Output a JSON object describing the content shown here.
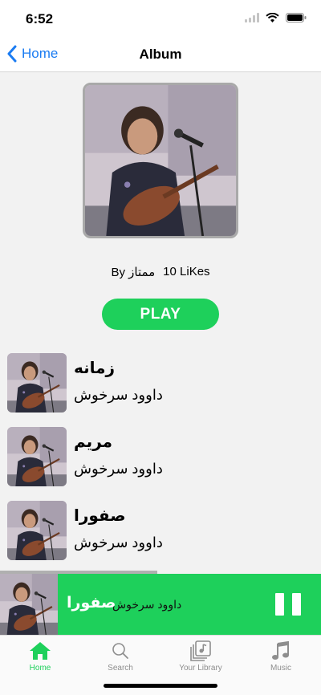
{
  "status": {
    "time": "6:52"
  },
  "nav": {
    "back_label": "Home",
    "title": "Album"
  },
  "album": {
    "by_text": "By ممتاز",
    "likes_text": "10 LiKes",
    "play_label": "PLAY"
  },
  "tracks": [
    {
      "title": "زمانه",
      "artist": "داوود سرخوش"
    },
    {
      "title": "مریم",
      "artist": "داوود سرخوش"
    },
    {
      "title": "صفورا",
      "artist": "داوود سرخوش"
    }
  ],
  "now_playing": {
    "title": "صفورا",
    "artist": "داوود سرخوش",
    "progress": 0.49
  },
  "tabs": [
    {
      "label": "Home",
      "icon": "home-icon",
      "active": true
    },
    {
      "label": "Search",
      "icon": "search-icon",
      "active": false
    },
    {
      "label": "Your Library",
      "icon": "library-icon",
      "active": false
    },
    {
      "label": "Music",
      "icon": "music-note-icon",
      "active": false
    }
  ],
  "colors": {
    "accent": "#1ed05b",
    "link": "#1b7cf2",
    "background": "#f2f2f2",
    "inactive_tab": "#8e8e8e"
  }
}
